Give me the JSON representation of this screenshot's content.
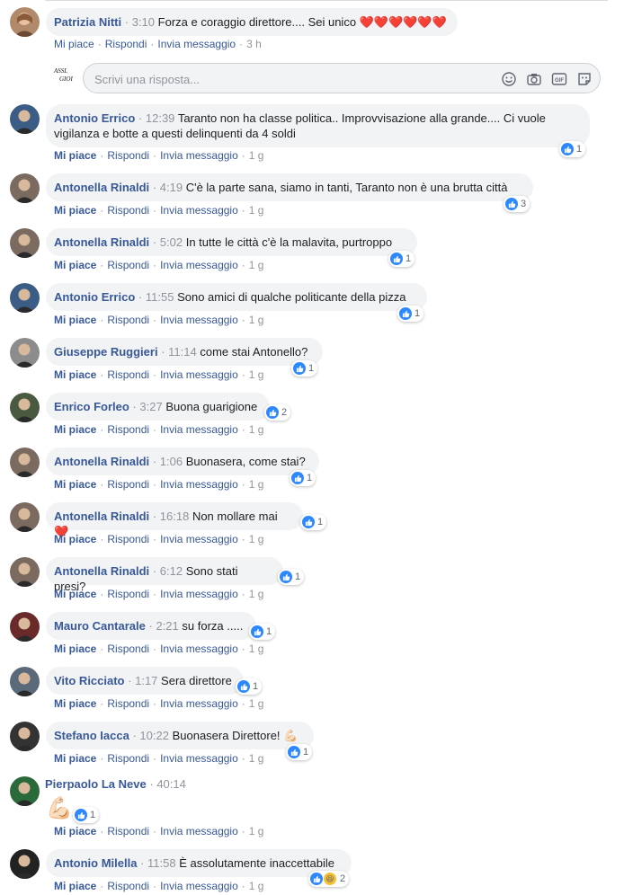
{
  "top_comment": {
    "name": "Patrizia Nitti",
    "time": "3:10",
    "text": "Forza e coraggio direttore.... Sei unico ",
    "hearts": "❤️❤️❤️❤️❤️❤️",
    "age": "3 h"
  },
  "reply_box": {
    "placeholder": "Scrivi una risposta...",
    "avatar_text_1": "ASSL",
    "avatar_text_2": "GIOI",
    "icons": [
      "emoji-icon",
      "camera-icon",
      "gif-icon",
      "sticker-icon"
    ]
  },
  "labels": {
    "like": "Mi piace",
    "reply": "Rispondi",
    "message": "Invia messaggio",
    "separator": "·"
  },
  "comments": [
    {
      "name": "Antonio Errico",
      "time": "12:39",
      "text": "Taranto non ha classe politica.. Improvvisazione alla grande.... Ci vuole",
      "text2": "vigilanza e botte a questi delinquenti da 4 soldi",
      "age": "1 g",
      "reactions": "1"
    },
    {
      "name": "Antonella Rinaldi",
      "time": "4:19",
      "text": "C'è la parte sana, siamo in tanti, Taranto non è una brutta città",
      "age": "1 g",
      "reactions": "3"
    },
    {
      "name": "Antonella Rinaldi",
      "time": "5:02",
      "text": "In tutte le città c'è la malavita, purtroppo",
      "age": "1 g",
      "reactions": "1"
    },
    {
      "name": "Antonio Errico",
      "time": "11:55",
      "text": "Sono amici di qualche politicante della pizza",
      "age": "1 g",
      "reactions": "1"
    },
    {
      "name": "Giuseppe Ruggieri",
      "time": "11:14",
      "text": "come stai Antonello?",
      "age": "1 g",
      "reactions": "1"
    },
    {
      "name": "Enrico Forleo",
      "time": "3:27",
      "text": "Buona guarigione",
      "age": "1 g",
      "reactions": "2"
    },
    {
      "name": "Antonella Rinaldi",
      "time": "1:06",
      "text": "Buonasera, come stai?",
      "age": "1 g",
      "reactions": "1"
    },
    {
      "name": "Antonella Rinaldi",
      "time": "16:18",
      "text": "Non mollare mai ",
      "heart": "❤️",
      "age": "1 g",
      "reactions": "1"
    },
    {
      "name": "Antonella Rinaldi",
      "time": "6:12",
      "text": "Sono stati presi?",
      "age": "1 g",
      "reactions": "1"
    },
    {
      "name": "Mauro Cantarale",
      "time": "2:21",
      "text": "su forza .....",
      "age": "1 g",
      "reactions": "1"
    },
    {
      "name": "Vito Ricciato",
      "time": "1:17",
      "text": "Sera direttore",
      "age": "1 g",
      "reactions": "1"
    },
    {
      "name": "Stefano Iacca",
      "time": "10:22",
      "text": "Buonasera Direttore! ",
      "emoji": "💪🏻",
      "age": "1 g",
      "reactions": "1"
    },
    {
      "name": "Pierpaolo La Neve",
      "time": "40:14",
      "emoji": "💪🏻",
      "age": "1 g",
      "reactions": "1"
    },
    {
      "name": "Antonio Milella",
      "time": "11:58",
      "text": "È assolutamente inaccettabile",
      "age": "1 g",
      "reactions": "2"
    }
  ],
  "colors": {
    "name": "#385898",
    "muted": "#90949c",
    "bubble": "#f2f3f5",
    "like_blue": "#2d88ff",
    "heart": "#e0245e"
  }
}
